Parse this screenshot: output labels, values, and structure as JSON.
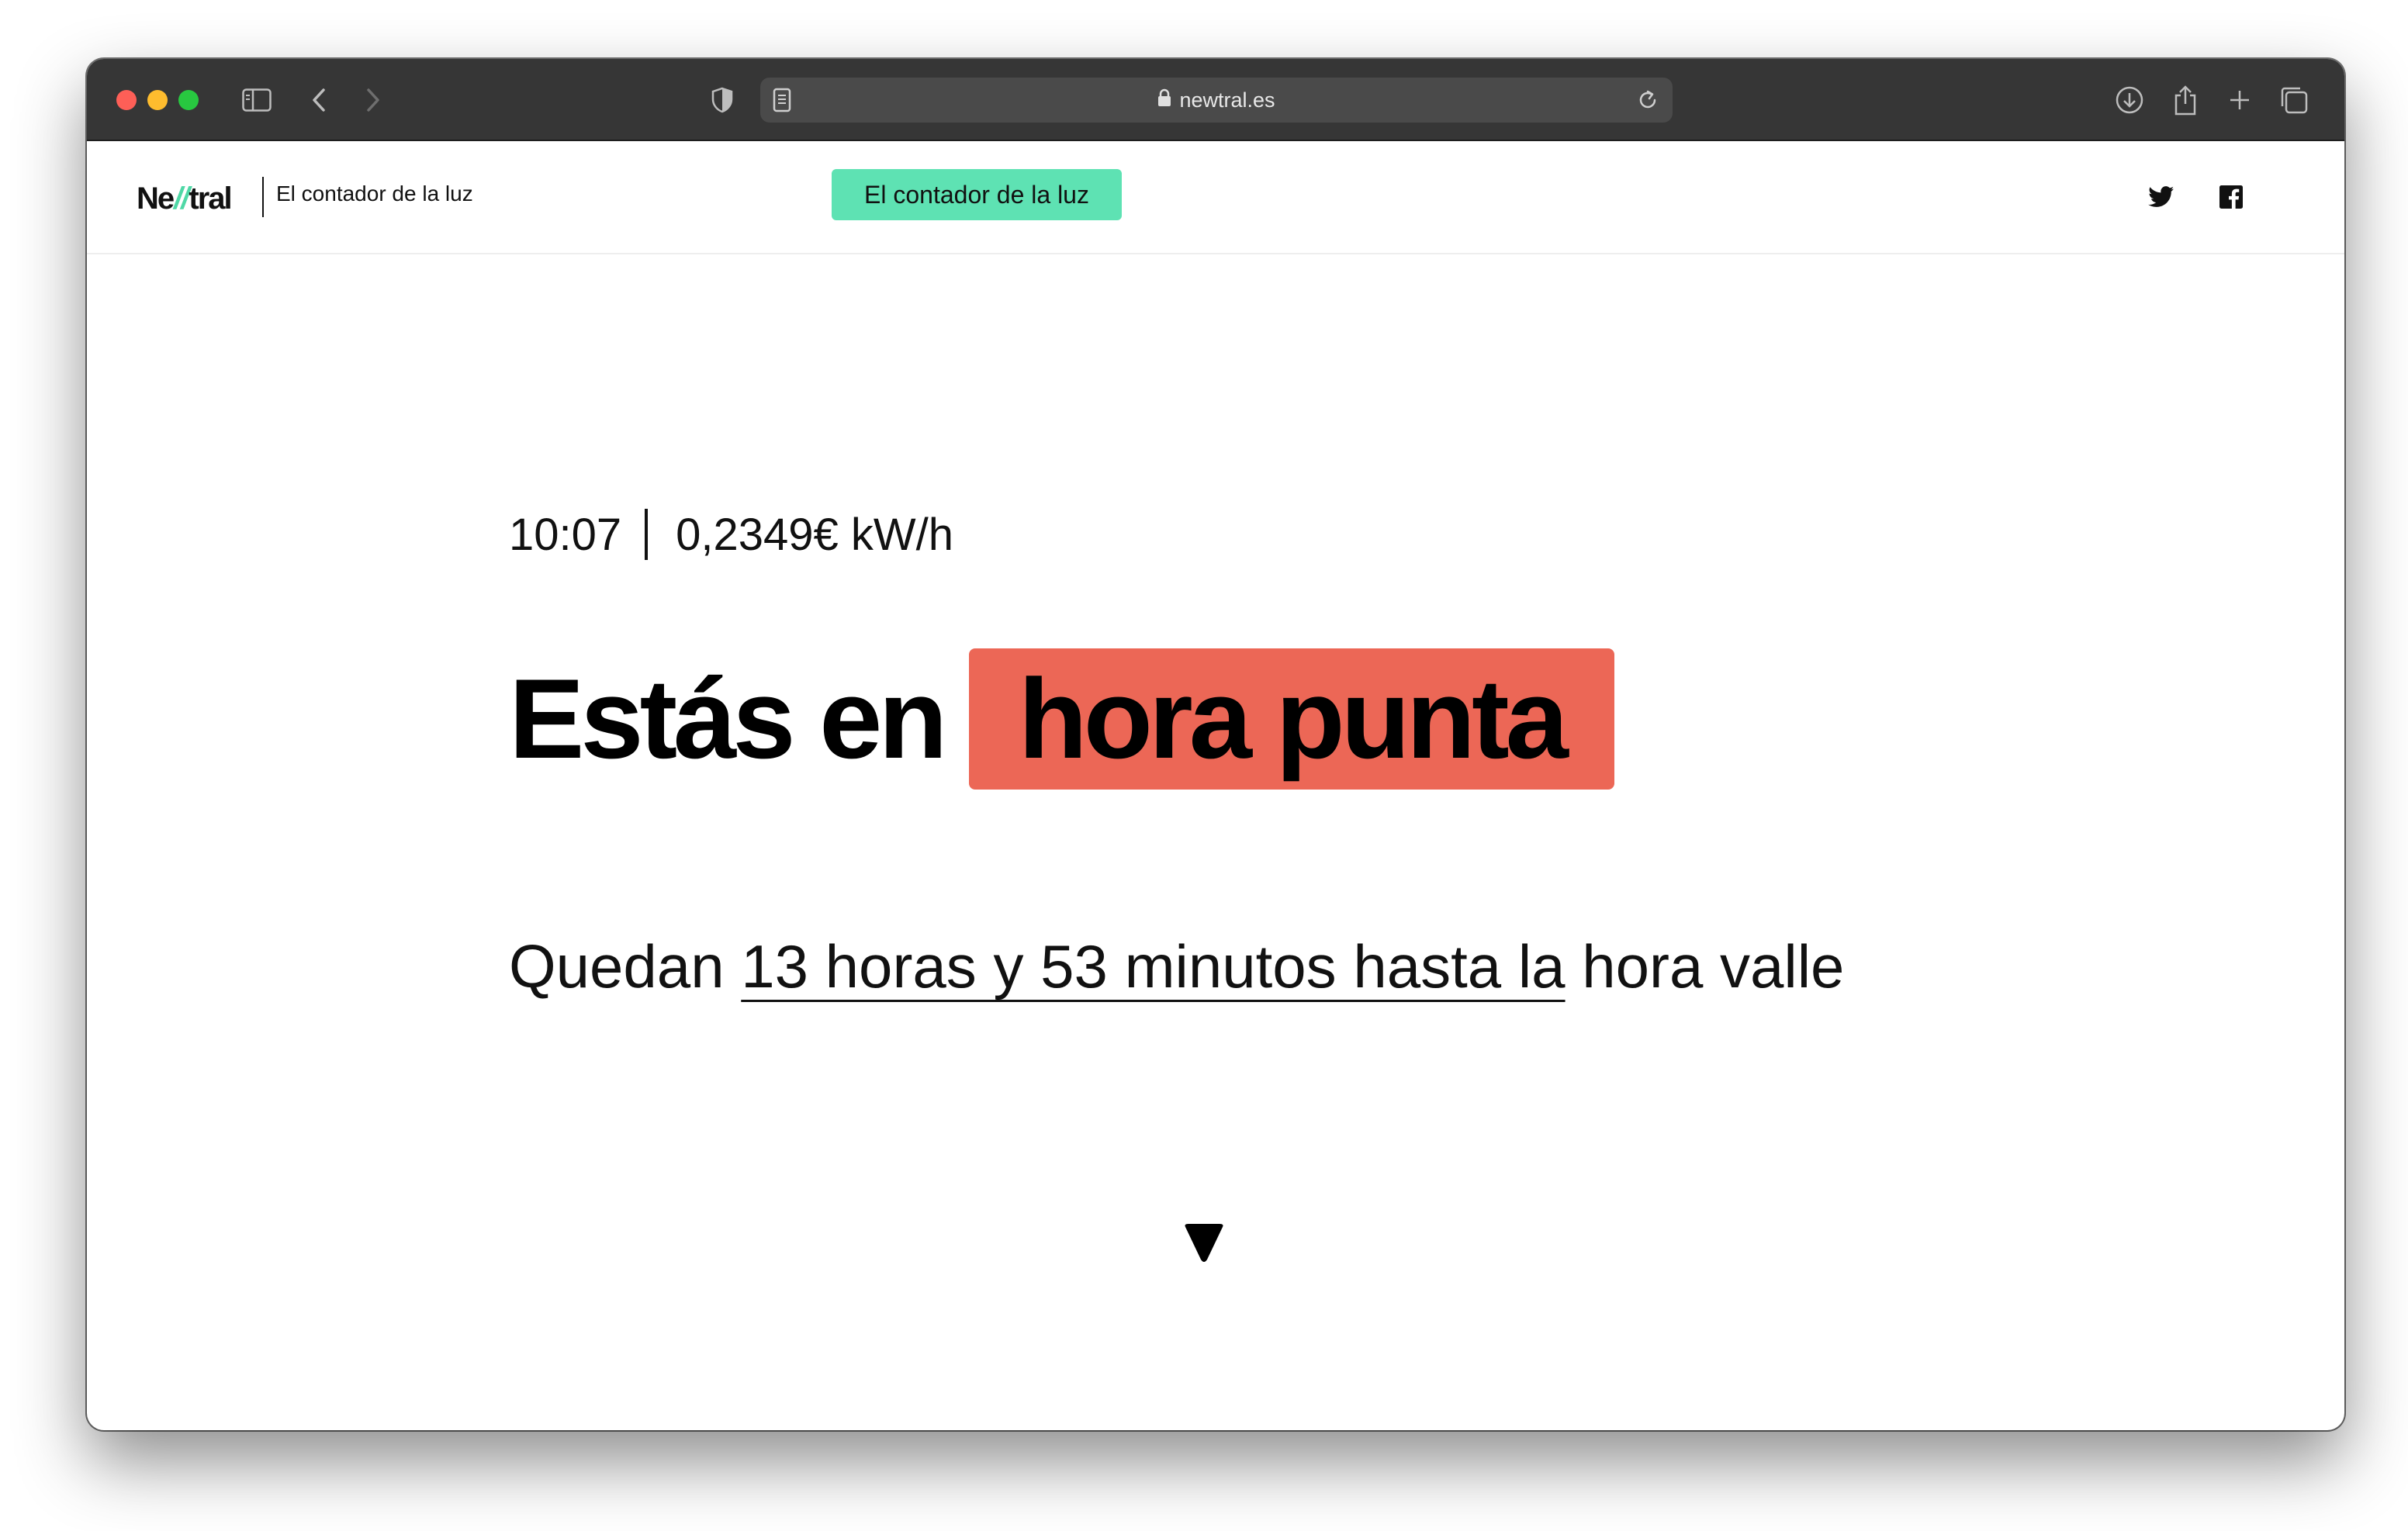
{
  "browser": {
    "url": "newtral.es"
  },
  "header": {
    "logo": {
      "part1": "Ne",
      "part2": "//",
      "part3": "tral"
    },
    "subtitle": "El contador de la luz",
    "pill_label": "El contador de la luz"
  },
  "hero": {
    "time": "10:07",
    "price": "0,2349€ kW/h",
    "headline_prefix": "Estás en",
    "headline_badge": "hora punta",
    "remaining_prefix": "Quedan",
    "remaining_underlined": "13 horas y 53 minutos hasta la",
    "remaining_suffix": "hora valle"
  },
  "colors": {
    "accent_green": "#5ee2b3",
    "peak_red": "#ec6756",
    "titlebar": "#363636"
  },
  "icons": [
    "sidebar-icon",
    "back-icon",
    "forward-icon",
    "shield-icon",
    "page-icon",
    "lock-icon",
    "reload-icon",
    "download-icon",
    "share-icon",
    "new-tab-icon",
    "tabs-overview-icon",
    "twitter-icon",
    "facebook-icon",
    "scroll-down-arrow-icon"
  ]
}
